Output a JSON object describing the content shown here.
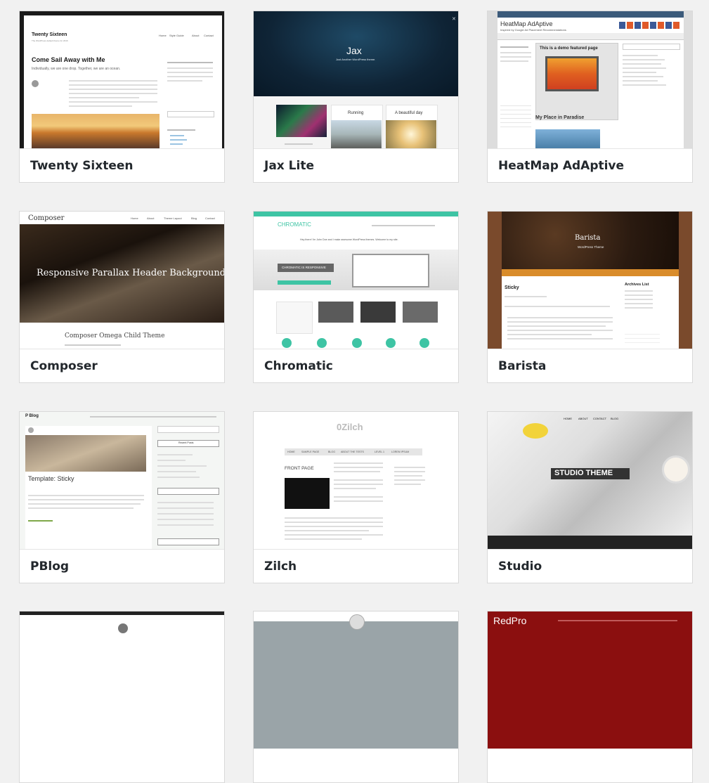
{
  "themes": [
    {
      "name": "Twenty Sixteen",
      "site_title": "Twenty Sixteen",
      "tagline": "The WordPress default theme for 2016",
      "nav": [
        "Home",
        "Style Guide",
        "About",
        "Contact"
      ],
      "post_title": "Come Sail Away with Me",
      "post_subtitle": "Individually, we are one drop. Together, we are an ocean."
    },
    {
      "name": "Jax Lite",
      "site_title": "Jax",
      "tagline": "Just Another WordPress theme.",
      "features": [
        "Running",
        "A beautiful day"
      ]
    },
    {
      "name": "HeatMap AdAptive",
      "site_title": "HeatMap AdAptive",
      "tagline": "Inspired by Google Ad Placement Recommendations",
      "demo_label": "This is a demo featured page",
      "post_title": "My Place in Paradise"
    },
    {
      "name": "Composer",
      "site_title": "Composer",
      "nav": [
        "Home",
        "About",
        "Theme Layout",
        "Blog",
        "Contact"
      ],
      "hero_text": "Responsive Parallax Header Background",
      "child_title": "Composer Omega Child Theme"
    },
    {
      "name": "Chromatic",
      "site_title": "CHROMATIC",
      "intro": "Hey there! I'm John Doe and I make awesome WordPress themes. Welcome to my site.",
      "hero_text": "CHROMATIC IS RESPONSIVE"
    },
    {
      "name": "Barista",
      "site_title": "Barista",
      "tagline": "WordPress Theme",
      "post_title": "Sticky",
      "sidebar_heading": "Archives List"
    },
    {
      "name": "PBlog",
      "site_title": "P Blog",
      "post_title": "Template: Sticky",
      "sidebar_heading": "Recent Posts"
    },
    {
      "name": "Zilch",
      "site_title": "0Zilch",
      "nav": [
        "HOME",
        "SAMPLE PAGE",
        "BLOG",
        "ABOUT THE TESTS",
        "LEVEL 1",
        "LOREM IPSUM"
      ],
      "page_title": "FRONT PAGE"
    },
    {
      "name": "Studio",
      "hero_text": "STUDIO THEME",
      "nav": [
        "HOME",
        "ABOUT",
        "CONTACT",
        "BLOG"
      ]
    },
    {
      "name": "",
      "site_title": ""
    },
    {
      "name": "",
      "site_title": ""
    },
    {
      "name": "",
      "site_title": "RedPro"
    }
  ],
  "colors": {
    "page_bg": "#f1f1f1",
    "chromatic_accent": "#3ec4a4",
    "barista_brown": "#7a4a2c",
    "barista_orange": "#d98c2b",
    "redpro_red": "#8b0f0f",
    "heatmap_orange": "#f0a030"
  }
}
